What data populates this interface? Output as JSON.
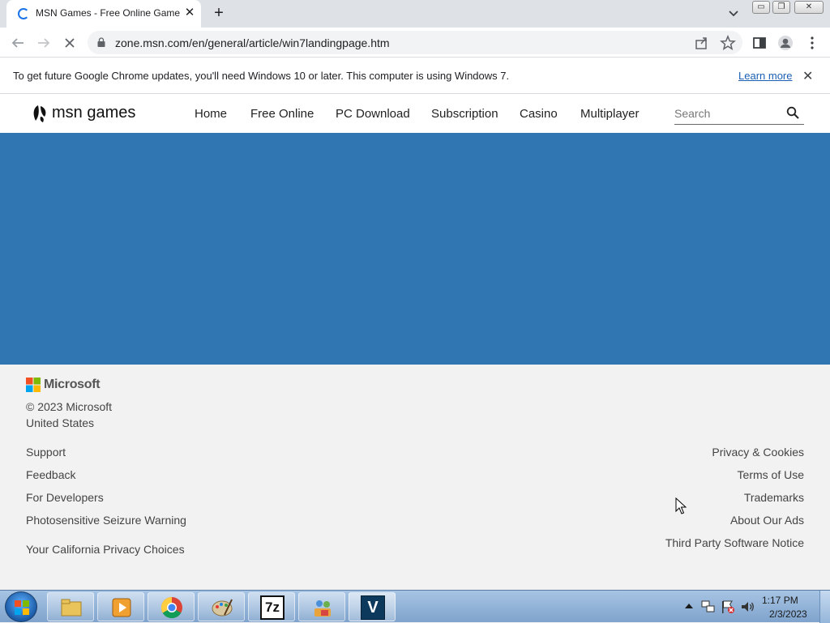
{
  "browser": {
    "tab_title": "MSN Games - Free Online Games",
    "tab_close": "✕",
    "new_tab": "+",
    "url": "zone.msn.com/en/general/article/win7landingpage.htm",
    "url_host": "zone.msn.com",
    "window_buttons": {
      "minimize": "▭",
      "restore": "❐",
      "close": "✕"
    }
  },
  "infobar": {
    "message": "To get future Google Chrome updates, you'll need Windows 10 or later. This computer is using Windows 7.",
    "learn_more": "Learn more",
    "close": "✕"
  },
  "msn": {
    "logo_text": "msn games",
    "nav": [
      "Home",
      "Free Online",
      "PC Download",
      "Subscription",
      "Casino",
      "Multiplayer"
    ],
    "search_placeholder": "Search"
  },
  "footer": {
    "brand": "Microsoft",
    "copyright": "© 2023 Microsoft",
    "region": "United States",
    "left_links": [
      "Support",
      "Feedback",
      "For Developers",
      "Photosensitive Seizure Warning",
      "Your California Privacy Choices"
    ],
    "right_links": [
      "Privacy & Cookies",
      "Terms of Use",
      "Trademarks",
      "About Our Ads",
      "Third Party Software Notice"
    ]
  },
  "taskbar": {
    "apps": [
      "file-explorer",
      "media-player",
      "chrome",
      "paint",
      "7-zip",
      "network-users",
      "v-app"
    ],
    "app_7zip_label": "7z",
    "app_v_label": "V",
    "time": "1:17 PM",
    "date": "2/3/2023"
  },
  "colors": {
    "hero_blue": "#3076b2",
    "link_blue": "#1a5fb4",
    "chrome_tab_strip": "#dee1e6"
  }
}
